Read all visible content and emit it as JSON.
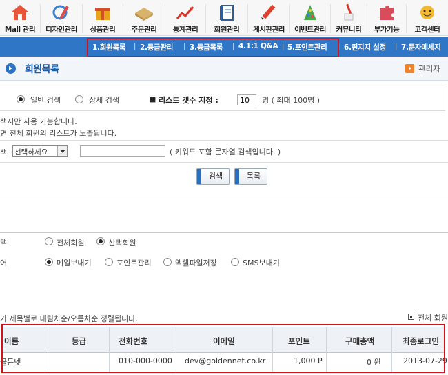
{
  "top_menu": {
    "items": [
      {
        "label": "Mall 관리",
        "icon": "house-icon"
      },
      {
        "label": "디자인관리",
        "icon": "design-tools-icon"
      },
      {
        "label": "상품관리",
        "icon": "gift-box-icon"
      },
      {
        "label": "주문관리",
        "icon": "order-box-icon"
      },
      {
        "label": "통계관리",
        "icon": "chart-arrow-icon"
      },
      {
        "label": "회원관리",
        "icon": "member-book-icon"
      },
      {
        "label": "게시판관리",
        "icon": "pencil-icon"
      },
      {
        "label": "이벤트관리",
        "icon": "party-hat-icon"
      },
      {
        "label": "커뮤니티",
        "icon": "pen-cup-icon"
      },
      {
        "label": "부가기능",
        "icon": "puzzle-icon"
      },
      {
        "label": "고객센터",
        "icon": "chat-bubble-icon"
      }
    ]
  },
  "sub_nav": {
    "items": [
      "1.회원목록",
      "2.등급관리",
      "3.등급목록",
      "4.1:1 Q&A",
      "5.포인트관리",
      "6.편지지 설정",
      "7.문자메세지"
    ]
  },
  "page": {
    "title": "회원목록",
    "admin_link": "관리자"
  },
  "search_options": {
    "mode_simple": "일반 검색",
    "mode_detail": "상세 검색",
    "list_count_label": "리스트 갯수 지정 :",
    "list_count_value": "10",
    "list_count_suffix": "명 ( 최대 100명 )"
  },
  "notes": {
    "line1": "색시만 사용 가능합니다.",
    "line2": "면 전체 회원의 리스트가 노출됩니다."
  },
  "search_form": {
    "label": "색",
    "select_value": "선택하세요",
    "keyword_hint": "( 키워드 포함 문자열 검색입니다. )",
    "search_button": "검색",
    "list_button": "목록"
  },
  "target_row": {
    "label": "택",
    "all_members": "전체회원",
    "selected_members": "선택회원"
  },
  "action_row": {
    "label": "어",
    "send_mail": "메일보내기",
    "point_manage": "포인트관리",
    "excel_save": "엑셀파일저장",
    "send_sms": "SMS보내기"
  },
  "sort_note": "가 제목별로 내림차순/오름차순 정렬됩니다.",
  "select_all_label": "전체 회원",
  "table": {
    "headers": [
      "이름",
      "등급",
      "전화번호",
      "이메일",
      "포인트",
      "구매총액",
      "최종로그인"
    ],
    "rows": [
      [
        "골든넷",
        "",
        "010-000-0000",
        "dev@goldennet.co.kr",
        "1,000 P",
        "0 원",
        "2013-07-29"
      ]
    ]
  }
}
